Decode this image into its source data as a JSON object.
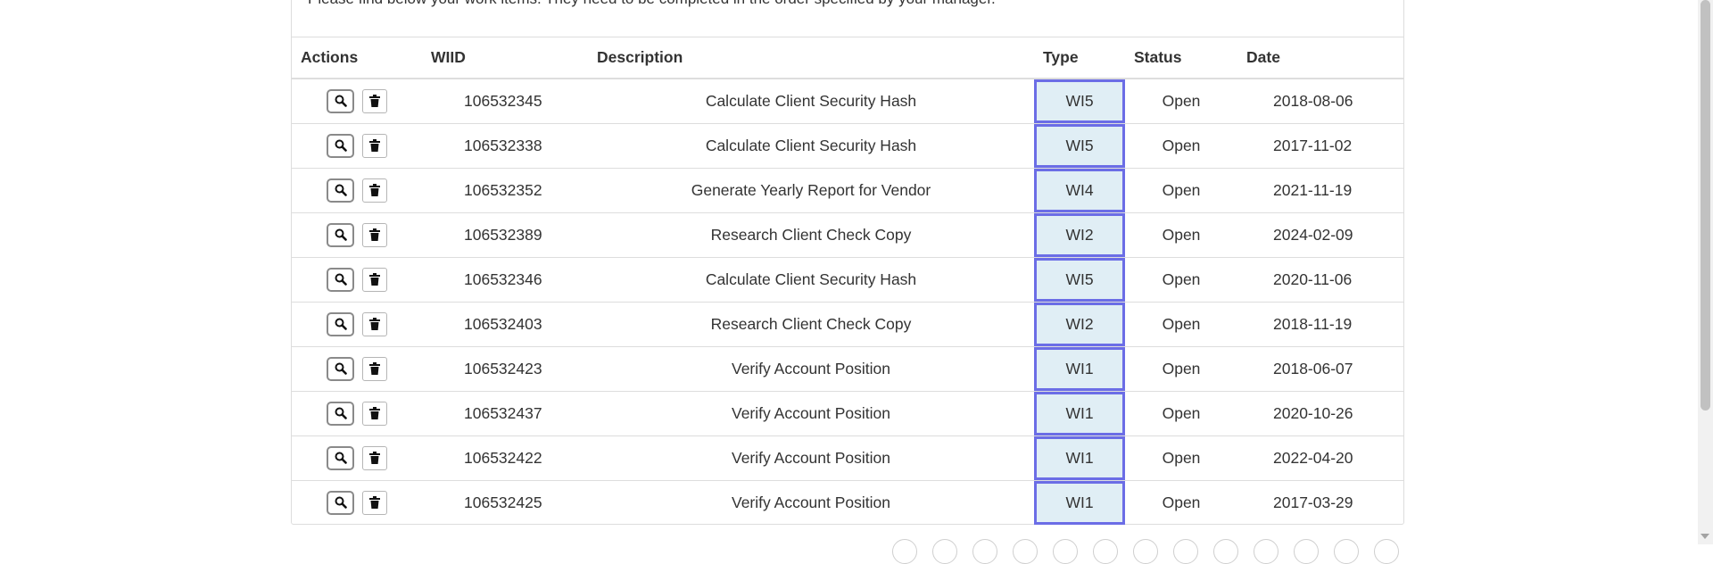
{
  "intro_text": "Please find below your work items. They need to be completed in the order specified by your manager.",
  "table": {
    "headers": {
      "actions": "Actions",
      "wiid": "WIID",
      "description": "Description",
      "type": "Type",
      "status": "Status",
      "date": "Date"
    },
    "rows": [
      {
        "wiid": "106532345",
        "description": "Calculate Client Security Hash",
        "type": "WI5",
        "status": "Open",
        "date": "2018-08-06"
      },
      {
        "wiid": "106532338",
        "description": "Calculate Client Security Hash",
        "type": "WI5",
        "status": "Open",
        "date": "2017-11-02"
      },
      {
        "wiid": "106532352",
        "description": "Generate Yearly Report for Vendor",
        "type": "WI4",
        "status": "Open",
        "date": "2021-11-19"
      },
      {
        "wiid": "106532389",
        "description": "Research Client Check Copy",
        "type": "WI2",
        "status": "Open",
        "date": "2024-02-09"
      },
      {
        "wiid": "106532346",
        "description": "Calculate Client Security Hash",
        "type": "WI5",
        "status": "Open",
        "date": "2020-11-06"
      },
      {
        "wiid": "106532403",
        "description": "Research Client Check Copy",
        "type": "WI2",
        "status": "Open",
        "date": "2018-11-19"
      },
      {
        "wiid": "106532423",
        "description": "Verify Account Position",
        "type": "WI1",
        "status": "Open",
        "date": "2018-06-07"
      },
      {
        "wiid": "106532437",
        "description": "Verify Account Position",
        "type": "WI1",
        "status": "Open",
        "date": "2020-10-26"
      },
      {
        "wiid": "106532422",
        "description": "Verify Account Position",
        "type": "WI1",
        "status": "Open",
        "date": "2022-04-20"
      },
      {
        "wiid": "106532425",
        "description": "Verify Account Position",
        "type": "WI1",
        "status": "Open",
        "date": "2017-03-29"
      }
    ]
  },
  "icons": {
    "view": "search-icon",
    "delete": "trash-icon"
  },
  "colors": {
    "type_cell_bg": "#e0eef5",
    "type_cell_border": "#6b6de6"
  }
}
